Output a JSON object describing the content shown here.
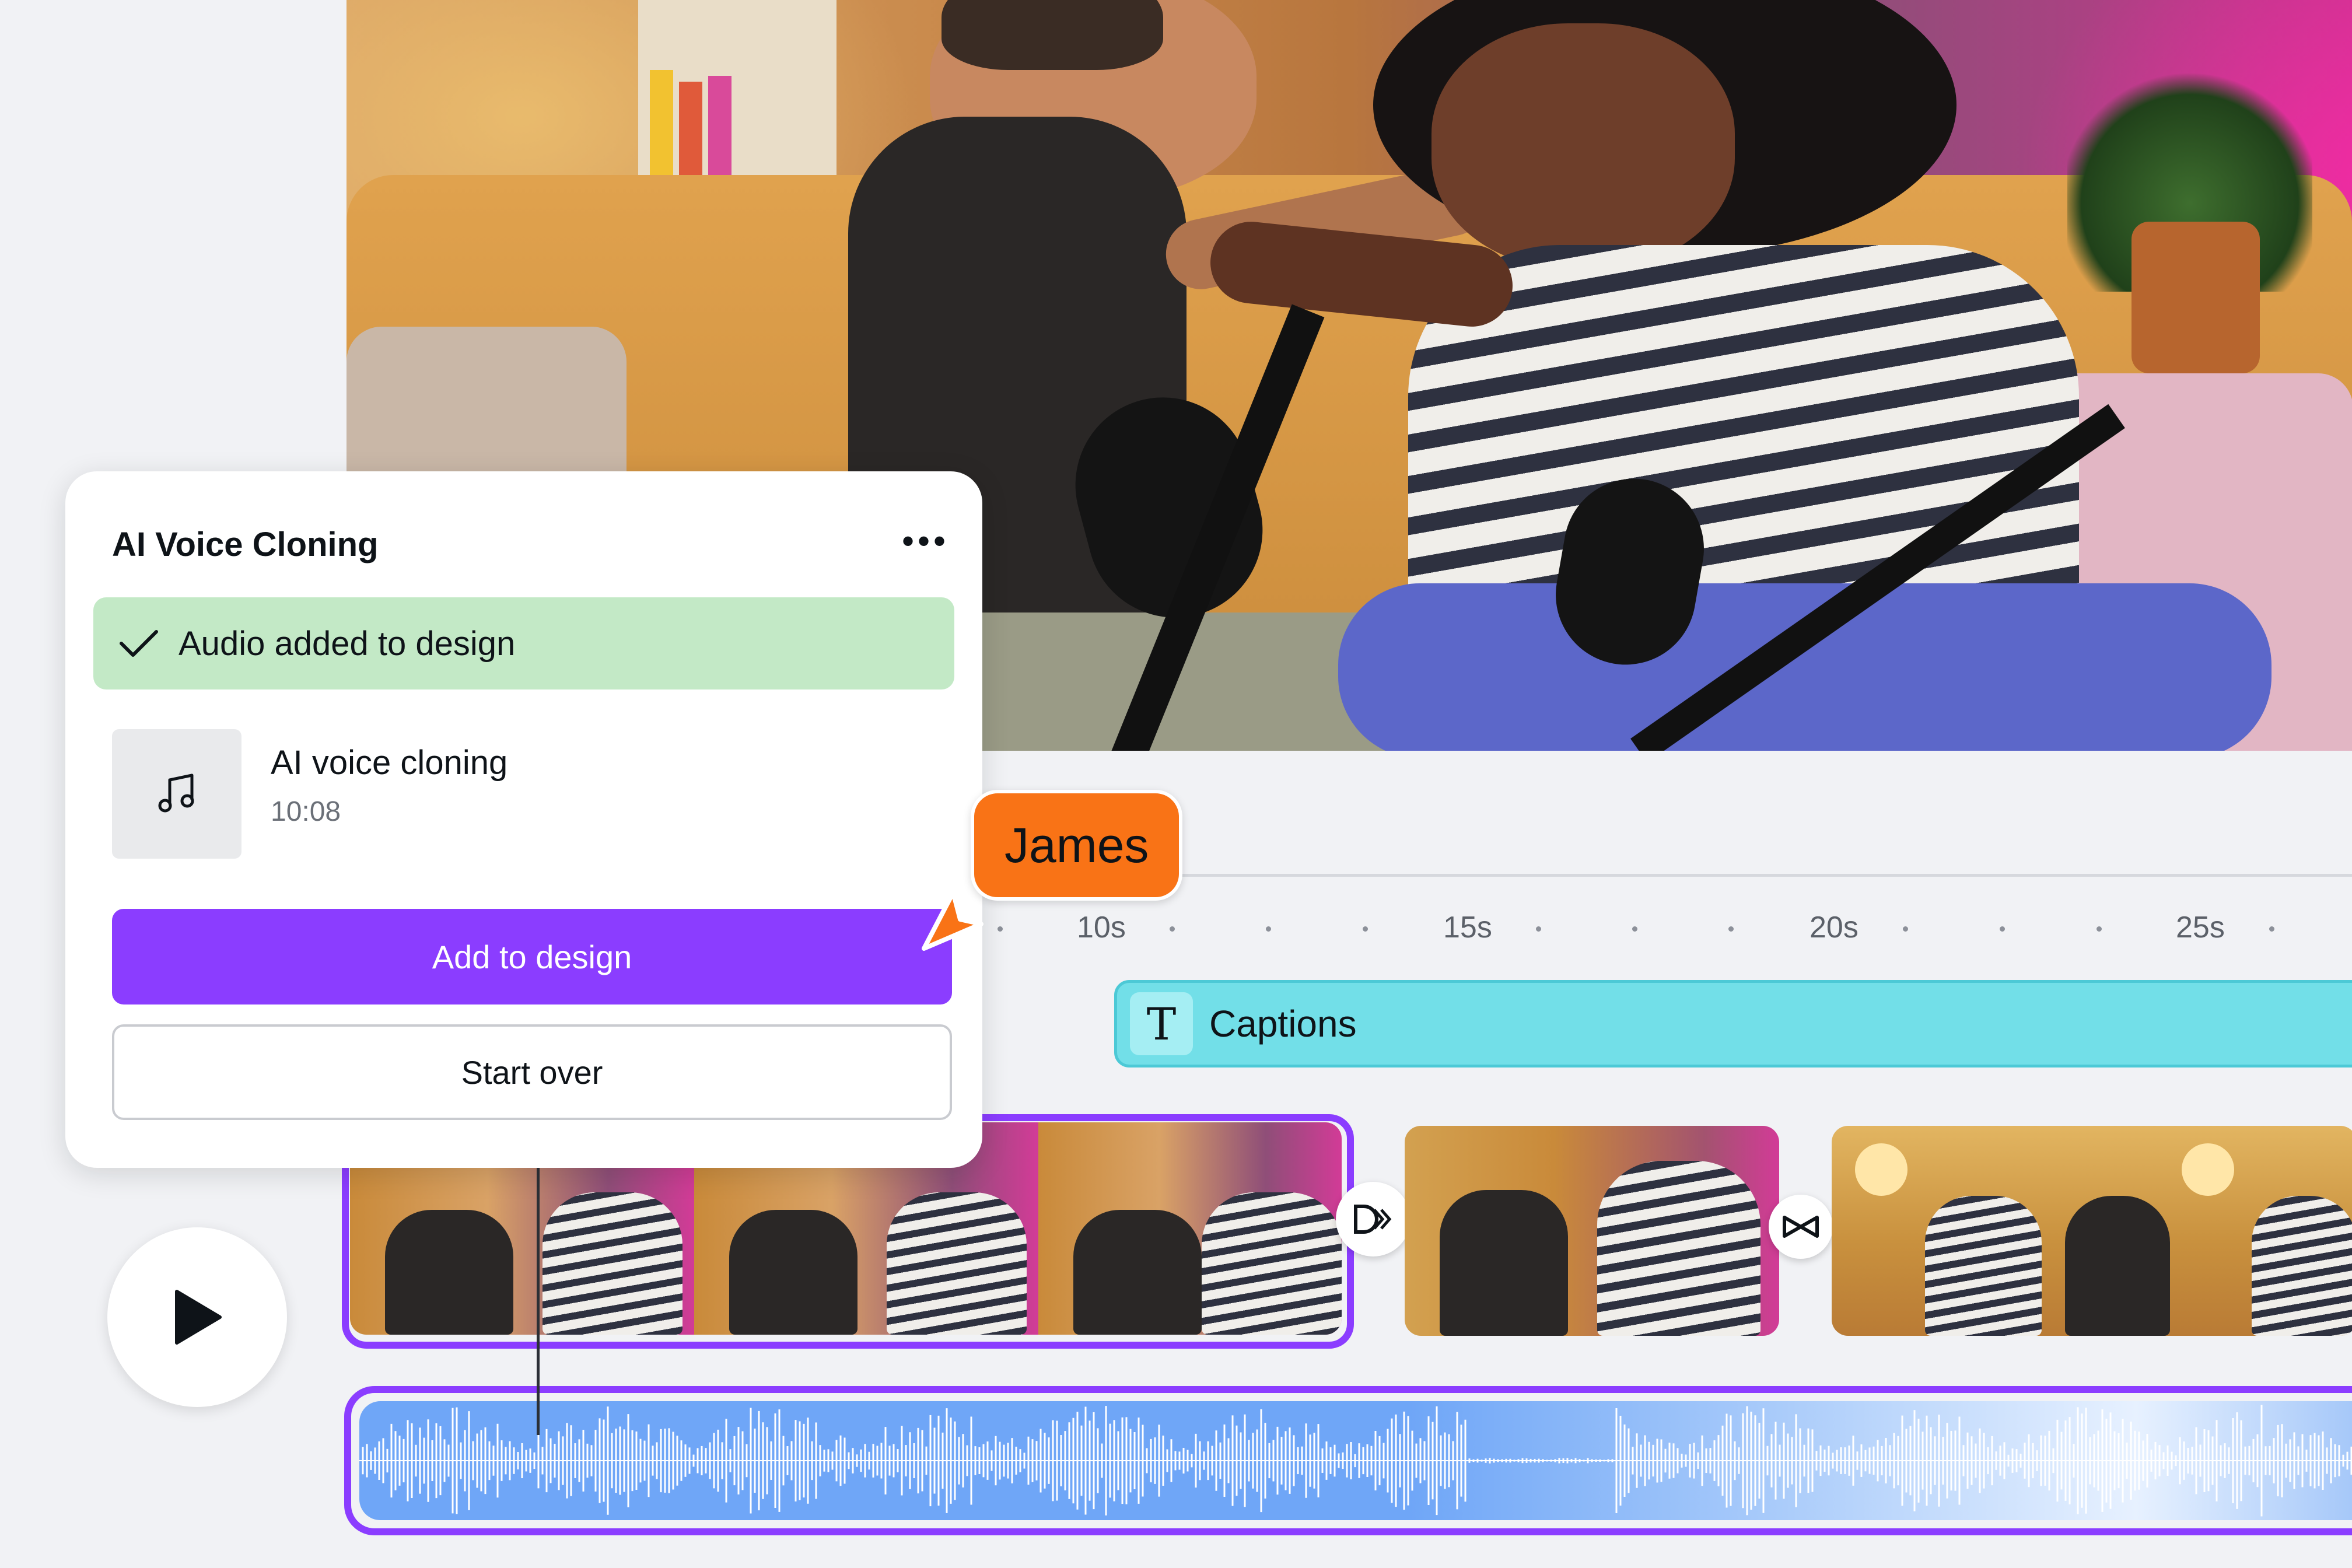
{
  "panel": {
    "title": "AI Voice Cloning",
    "more_label": "•••",
    "status_message": "Audio added to design",
    "audio_item": {
      "title": "AI voice cloning",
      "duration": "10:08"
    },
    "add_button_label": "Add to design",
    "start_over_label": "Start over"
  },
  "collaborator": {
    "name": "James",
    "color": "#F97316"
  },
  "timeline": {
    "ticks": [
      "10s",
      "15s",
      "20s",
      "25s"
    ],
    "captions_label": "Captions",
    "caption_icon_glyph": "T"
  },
  "colors": {
    "accent_purple": "#8B3DFF",
    "success_green": "#C3E9C6",
    "captions_cyan": "#72DFE8",
    "audio_blue": "#6FA6F7"
  },
  "icons": [
    "more-options-icon",
    "checkmark-icon",
    "music-note-icon",
    "text-icon",
    "play-icon",
    "transition-slide-icon",
    "transition-bowtie-icon",
    "cursor-pointer-icon"
  ]
}
